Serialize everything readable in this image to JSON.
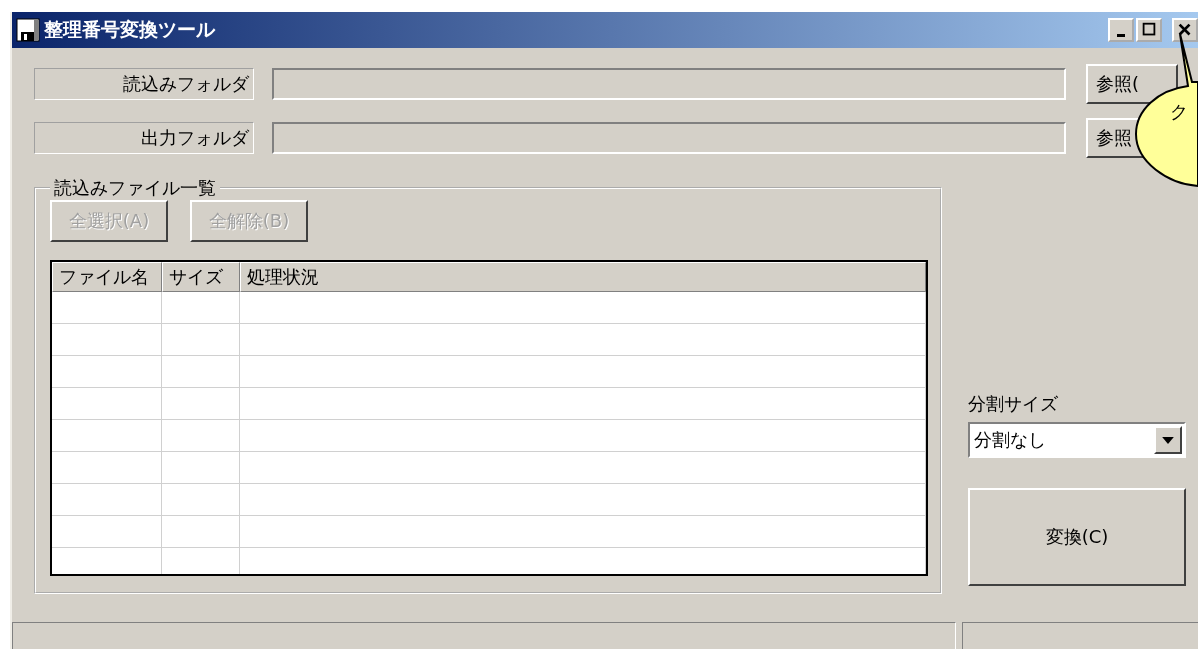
{
  "window": {
    "title": "整理番号変換ツール"
  },
  "folders": [
    {
      "label": "読込みフォルダ",
      "button": "参照("
    },
    {
      "label": "出力フォルダ",
      "button": "参照"
    }
  ],
  "file_list": {
    "legend": "読込みファイル一覧",
    "buttons": [
      {
        "label": "全選択(A)",
        "disabled": true
      },
      {
        "label": "全解除(B)",
        "disabled": true
      }
    ],
    "table": {
      "columns": [
        "ファイル名",
        "サイズ",
        "処理状況"
      ]
    }
  },
  "split_size": {
    "label": "分割サイズ",
    "value": "分割なし"
  },
  "convert_button": "変換(C)",
  "callout": {
    "text": "ク"
  }
}
